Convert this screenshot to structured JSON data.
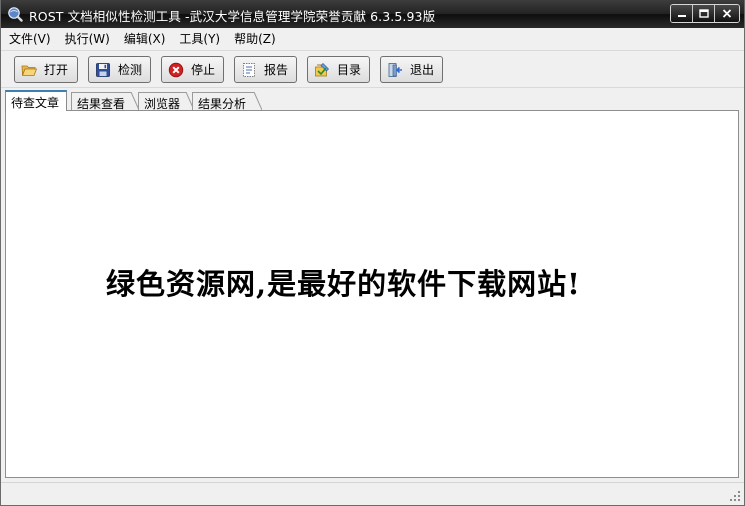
{
  "window": {
    "title": "ROST 文档相似性检测工具 -武汉大学信息管理学院荣誉贡献 6.3.5.93版",
    "app_icon": "magnifier-globe-icon",
    "controls": [
      "minimize-icon",
      "maximize-icon",
      "close-icon"
    ]
  },
  "menu": [
    {
      "label": "文件(V)"
    },
    {
      "label": "执行(W)"
    },
    {
      "label": "编辑(X)"
    },
    {
      "label": "工具(Y)"
    },
    {
      "label": "帮助(Z)"
    }
  ],
  "toolbar": {
    "open": {
      "label": "打开",
      "icon": "folder-open-icon"
    },
    "detect": {
      "label": "检测",
      "icon": "floppy-disk-icon"
    },
    "stop": {
      "label": "停止",
      "icon": "stop-circle-icon"
    },
    "report": {
      "label": "报告",
      "icon": "report-icon"
    },
    "catalog": {
      "label": "目录",
      "icon": "catalog-icon"
    },
    "exit": {
      "label": "退出",
      "icon": "exit-door-icon"
    }
  },
  "tabs": [
    {
      "label": "待查文章",
      "active": true
    },
    {
      "label": "结果查看",
      "active": false
    },
    {
      "label": "浏览器",
      "active": false
    },
    {
      "label": "结果分析",
      "active": false
    }
  ],
  "content": {
    "banner_text": "绿色资源网,是最好的软件下载网站!"
  },
  "colors": {
    "titlebar": "#1a1a1a",
    "active_tab_accent": "#3c7fb1",
    "stop_red": "#d32020"
  }
}
